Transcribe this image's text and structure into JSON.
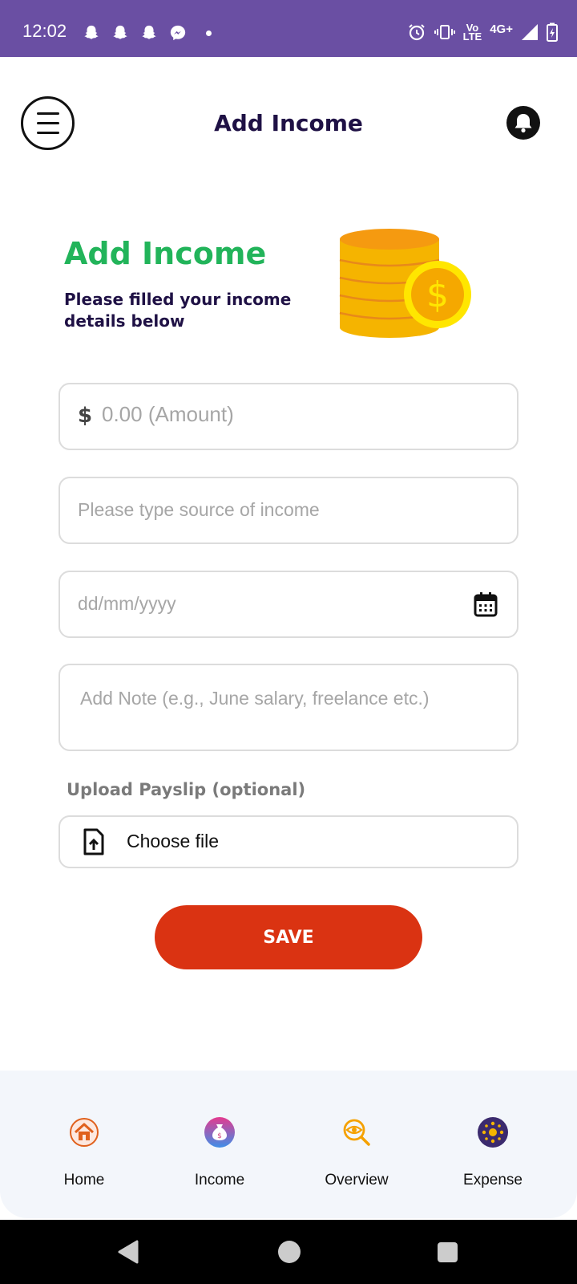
{
  "status_bar": {
    "time": "12:02",
    "notification_icons": [
      "snapchat-icon",
      "snapchat-icon",
      "snapchat-icon",
      "messenger-icon"
    ],
    "network": "4G+",
    "volte_line1": "Vo",
    "volte_line2": "LTE",
    "right_icons": [
      "alarm-icon",
      "vibrate-icon",
      "volte-icon",
      "signal-icon",
      "battery-charging-icon"
    ]
  },
  "header": {
    "title": "Add Income",
    "menu_icon": "hamburger-menu-icon",
    "bell_icon": "bell-icon"
  },
  "hero": {
    "title": "Add Income",
    "subtitle": "Please filled your income details below",
    "illustration": "coins-icon"
  },
  "form": {
    "amount_symbol": "$",
    "amount_placeholder": "0.00 (Amount)",
    "source_placeholder": "Please type source of income",
    "date_placeholder": "dd/mm/yyyy",
    "note_placeholder": "Add Note (e.g., June salary, freelance etc.)",
    "upload_label": "Upload Payslip (optional)",
    "choose_file": "Choose file",
    "save": "SAVE"
  },
  "bottom_nav": {
    "items": [
      {
        "label": "Home",
        "icon": "home-icon"
      },
      {
        "label": "Income",
        "icon": "money-bag-icon"
      },
      {
        "label": "Overview",
        "icon": "search-eye-icon"
      },
      {
        "label": "Expense",
        "icon": "expense-icon"
      }
    ]
  },
  "colors": {
    "status_bar": "#6a4fa3",
    "hero_title": "#22b45a",
    "heading": "#1f1145",
    "save_button": "#da3312",
    "nav_bg": "#f3f6fb"
  }
}
